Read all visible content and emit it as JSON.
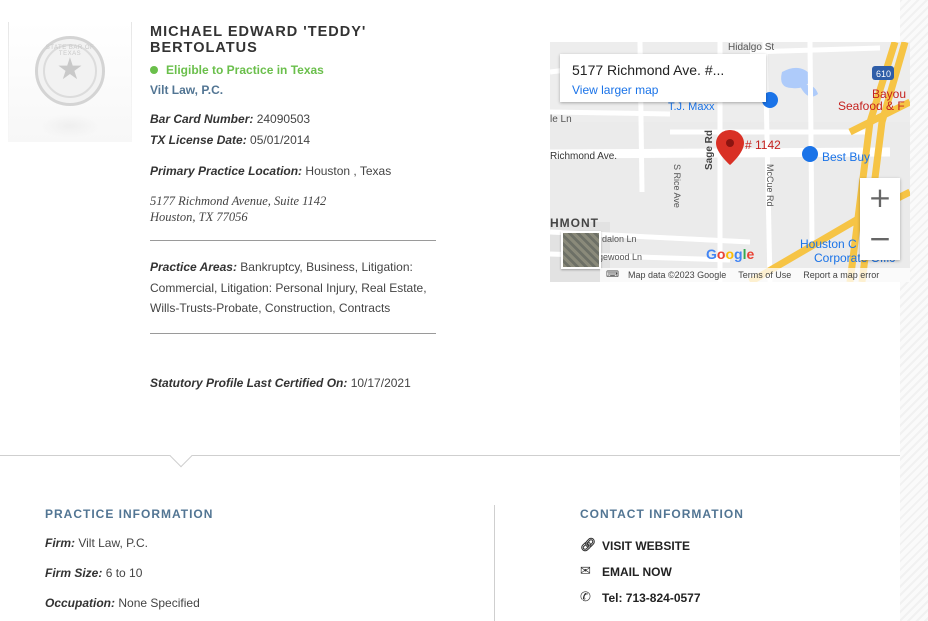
{
  "header": {
    "name": "MICHAEL EDWARD 'TEDDY' BERTOLATUS",
    "status": "Eligible to Practice in Texas",
    "firm": "Vilt Law, P.C."
  },
  "seal": {
    "text": "STATE BAR OF TEXAS"
  },
  "details": {
    "bar_card_label": "Bar Card Number:",
    "bar_card_value": "24090503",
    "license_label": "TX License Date:",
    "license_value": "05/01/2014",
    "location_label": "Primary Practice Location:",
    "location_value": "Houston , Texas",
    "address_line1": "5177 Richmond Avenue, Suite 1142",
    "address_line2": "Houston, TX 77056",
    "areas_label": "Practice Areas:",
    "areas_value": "Bankruptcy, Business, Litigation: Commercial, Litigation: Personal Injury, Real Estate, Wills-Trusts-Probate, Construction, Contracts",
    "certified_label": "Statutory Profile Last Certified On:",
    "certified_value": "10/17/2021"
  },
  "map": {
    "card_title": "5177 Richmond Ave. #...",
    "larger_map": "View larger map",
    "pin_label": "# 1142",
    "zoom_in": "+",
    "zoom_out": "−",
    "brand": "Google",
    "footer_data": "Map data ©2023 Google",
    "footer_terms": "Terms of Use",
    "footer_report": "Report a map error",
    "labels": {
      "hidalgo": "Hidalgo St",
      "bayou": "Bayou",
      "seafood": "Seafood & F",
      "tj": "T.J. Maxx",
      "richmond": "Richmond Ave.",
      "bestbuy": "Best Buy",
      "rice": "S Rice Ave",
      "sage": "Sage Rd",
      "mccue": "McCue Rd",
      "richmont": "HMONT",
      "dalon": "dalon Ln",
      "gewood": "gewood Ln",
      "houston": "Houston C",
      "corporate": "Corporate Offic",
      "le": "le Ln",
      "shield": "610"
    },
    "colors": {
      "road_major": "#f6c445",
      "pin": "#d93025",
      "link": "#1a73e8"
    }
  },
  "practice": {
    "heading": "PRACTICE INFORMATION",
    "firm_label": "Firm:",
    "firm_value": "Vilt Law, P.C.",
    "size_label": "Firm Size:",
    "size_value": "6 to 10",
    "occupation_label": "Occupation:",
    "occupation_value": "None Specified"
  },
  "contact": {
    "heading": "CONTACT INFORMATION",
    "website": "VISIT WEBSITE",
    "email": "EMAIL NOW",
    "phone": "Tel: 713-824-0577"
  }
}
